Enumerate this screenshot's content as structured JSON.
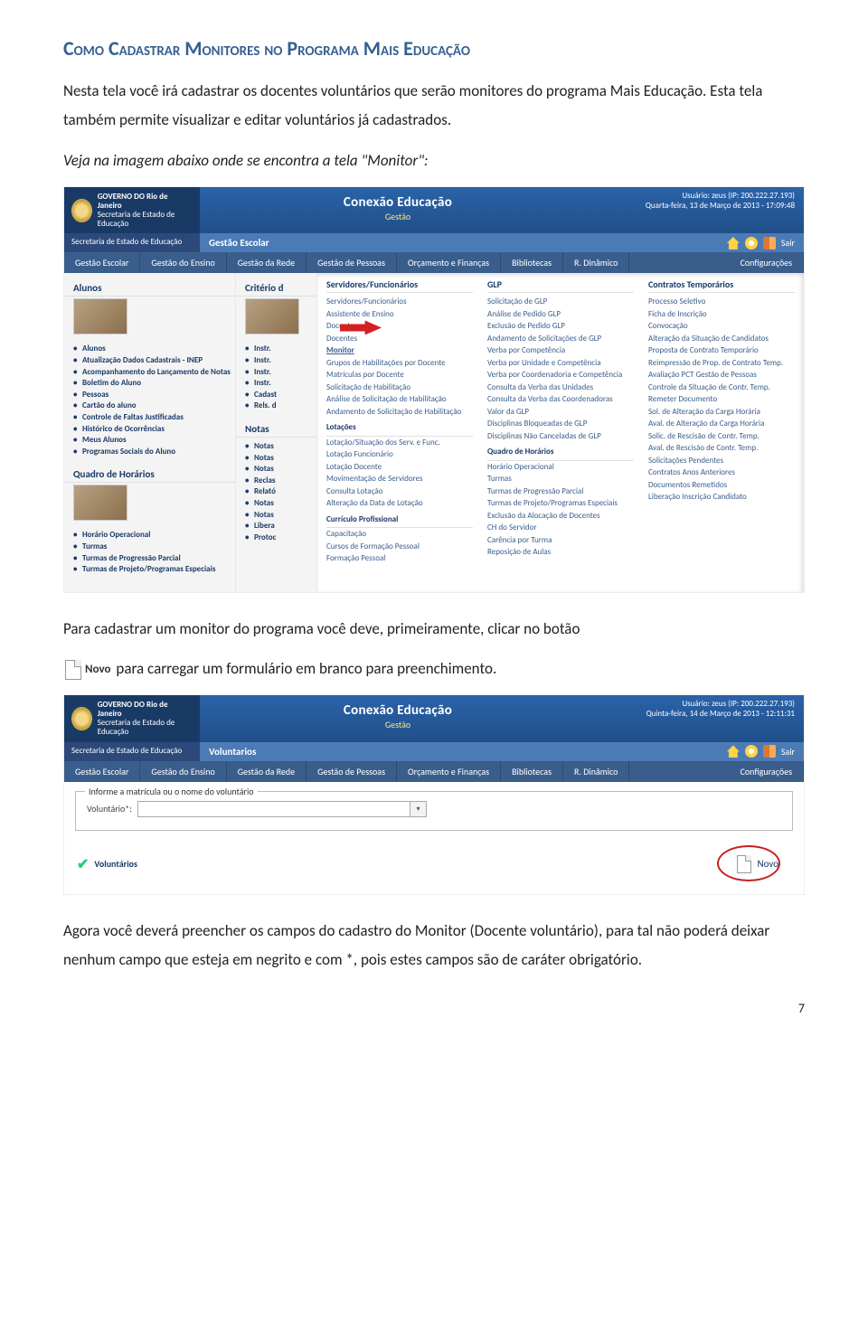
{
  "heading": "Como Cadastrar Monitores no Programa Mais Educação",
  "para1": "Nesta tela você irá cadastrar os docentes voluntários que serão monitores do programa Mais Educação. Esta tela também permite visualizar e editar voluntários já cadastrados.",
  "para2": "Veja na imagem abaixo onde se encontra a tela \"Monitor\":",
  "para3a": "Para cadastrar um monitor do programa você deve, primeiramente, clicar no botão",
  "novo_label": "Novo",
  "para3b": " para carregar um formulário em branco para preenchimento.",
  "para4": "Agora você deverá preencher os campos do cadastro do Monitor (Docente voluntário), para tal não poderá deixar nenhum campo que esteja em negrito e com *, pois estes campos são de caráter obrigatório.",
  "page_number": "7",
  "shot1": {
    "brand_top": "GOVERNO DO",
    "brand_main": "Rio de Janeiro",
    "brand_sub": "Secretaria de Estado de Educação",
    "app_title": "Conexão Educação",
    "app_sub": "Gestão",
    "user_line": "Usuário: zeus (IP: 200.222.27.193)",
    "date_line": "Quarta-feira, 13 de Março de 2013 - 17:09:48",
    "crumb": "Gestão Escolar",
    "sair": "Sair",
    "menu": [
      "Gestão Escolar",
      "Gestão do Ensino",
      "Gestão da Rede",
      "Gestão de Pessoas",
      "Orçamento e Finanças",
      "Bibliotecas",
      "R. Dinâmico",
      "Configurações"
    ],
    "side1_head": "Alunos",
    "side1_items": [
      "Alunos",
      "Atualização Dados Cadastrais - INEP",
      "Acompanhamento do Lançamento de Notas",
      "Boletim do Aluno",
      "Pessoas",
      "Cartão do aluno",
      "Controle de Faltas Justificadas",
      "Histórico de Ocorrências",
      "Meus Alunos",
      "Programas Sociais do Aluno"
    ],
    "side2_head": "Quadro de Horários",
    "side2_items": [
      "Horário Operacional",
      "Turmas",
      "Turmas de Progressão Parcial",
      "Turmas de Projeto/Programas Especiais"
    ],
    "mid1_head": "Critério d",
    "mid1_items": [
      "Instr.",
      "Instr.",
      "Instr.",
      "Instr.",
      "Cadast",
      "Rels. d"
    ],
    "mid2_head": "Notas",
    "mid2_items": [
      "Notas",
      "Notas",
      "Notas",
      "Reclas",
      "Relató",
      "Notas",
      "Notas",
      "Libera",
      "Protoc"
    ],
    "mega_col1_head": "Servidores/Funcionários",
    "mega_col1": [
      "Servidores/Funcionários",
      "Assistente de Ensino",
      "Docentes",
      "Docentes",
      "Monitor",
      "Grupos de Habilitações por Docente",
      "Matrículas por Docente",
      "Solicitação de Habilitação",
      "Análise de Solicitação de Habilitação",
      "Andamento de Solicitação de Habilitação"
    ],
    "mega_col1_sec2": "Lotações",
    "mega_col1b": [
      "Lotação/Situação dos Serv. e Func.",
      "Lotação Funcionário",
      "Lotação Docente",
      "Movimentação de Servidores",
      "Consulta Lotação",
      "Alteração da Data de Lotação"
    ],
    "mega_col1_sec3": "Currículo Profissional",
    "mega_col1c": [
      "Capacitação",
      "Cursos de Formação Pessoal",
      "Formação Pessoal"
    ],
    "mega_col2_head": "GLP",
    "mega_col2": [
      "Solicitação de GLP",
      "Análise de Pedido GLP",
      "Exclusão de Pedido GLP",
      "Andamento de Solicitações de GLP",
      "Verba por Competência",
      "Verba por Unidade e Competência",
      "Verba por Coordenadoria e Competência",
      "Consulta da Verba das Unidades",
      "Consulta da Verba das Coordenadoras",
      "Valor da GLP",
      "Disciplinas Bloqueadas de GLP",
      "Disciplinas Não Canceladas de GLP"
    ],
    "mega_col2_sec2": "Quadro de Horários",
    "mega_col2b": [
      "Horário Operacional",
      "Turmas",
      "Turmas de Progressão Parcial",
      "Turmas de Projeto/Programas Especiais",
      "Exclusão da Alocação de Docentes",
      "CH do Servidor",
      "Carência por Turma",
      "Reposição de Aulas"
    ],
    "mega_col3_head": "Contratos Temporários",
    "mega_col3": [
      "Processo Seletivo",
      "Ficha de Inscrição",
      "Convocação",
      "Alteração da Situação de Candidatos",
      "Proposta de Contrato Temporário",
      "Reimpressão de Prop. de Contrato Temp.",
      "Avaliação PCT Gestão de Pessoas",
      "Controle da Situação de Contr. Temp.",
      "Remeter Documento",
      "Sol. de Alteração da Carga Horária",
      "Aval. de Alteração da Carga Horária",
      "Solic. de Rescisão de Contr. Temp.",
      "Aval. de Rescisão de Contr. Temp.",
      "Solicitações Pendentes",
      "Contratos Anos Anteriores",
      "Documentos Remetidos",
      "Liberação Inscrição Candidato"
    ]
  },
  "shot2": {
    "date_line": "Quinta-feira, 14 de Março de 2013 - 12:11:31",
    "crumb": "Voluntarios",
    "legend": "Informe a matrícula ou o nome do voluntário",
    "field_label": "Voluntário*:",
    "voluntarios": "Voluntários",
    "novo": "Novo"
  }
}
